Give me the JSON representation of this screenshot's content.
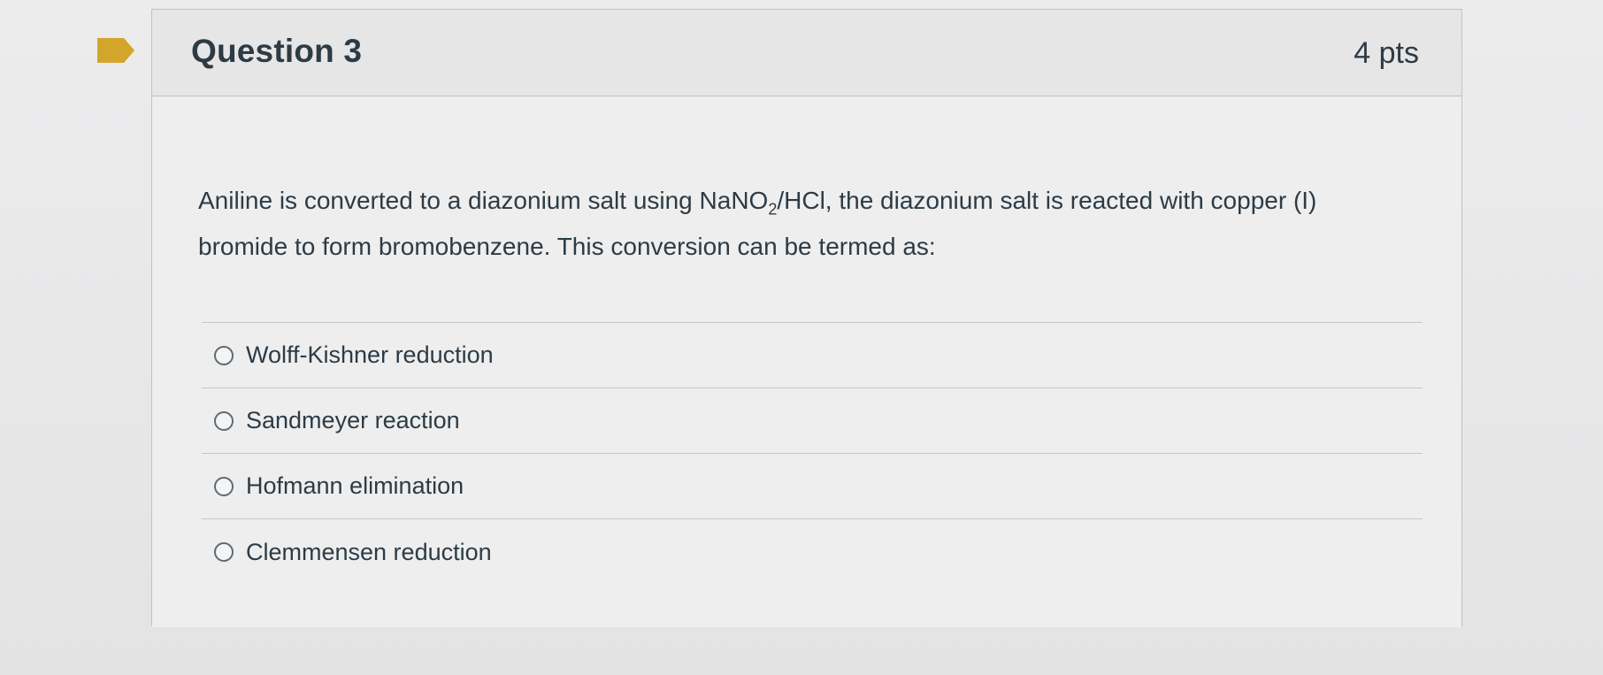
{
  "question": {
    "title": "Question 3",
    "points": "4 pts",
    "text_part1": "Aniline is converted to a diazonium salt using NaNO",
    "text_sub": "2",
    "text_part2": "/HCl, the diazonium salt is reacted with copper (I) bromide to form bromobenzene. This conversion can be termed as:",
    "flag_icon": "bookmark-flag-icon",
    "flag_color": "#d3a52a"
  },
  "answers": [
    {
      "label": "Wolff-Kishner reduction",
      "selected": false
    },
    {
      "label": "Sandmeyer reaction",
      "selected": false
    },
    {
      "label": "Hofmann elimination",
      "selected": false
    },
    {
      "label": "Clemmensen reduction",
      "selected": false
    }
  ]
}
